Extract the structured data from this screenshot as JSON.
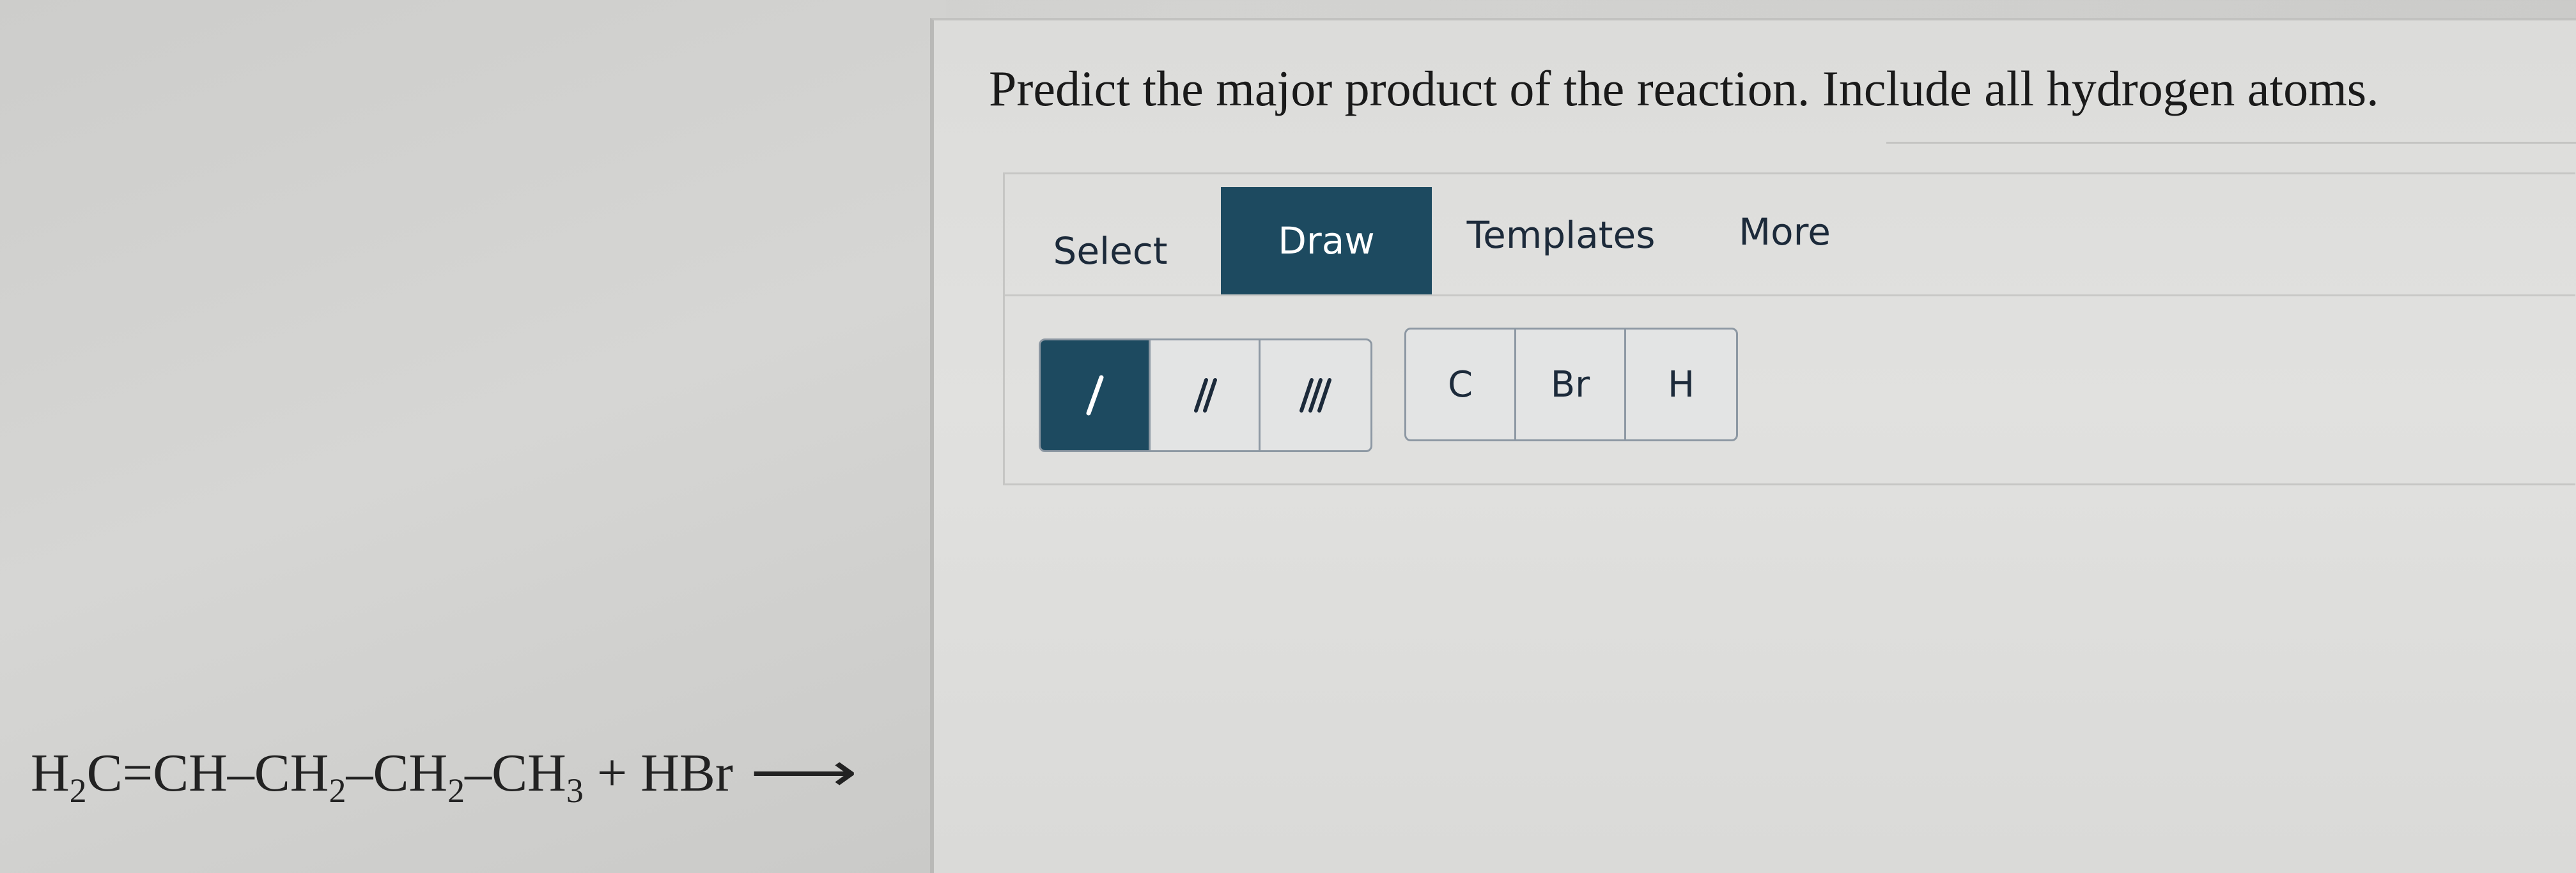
{
  "question": {
    "text": "Predict the major product of the reaction. Include all hydrogen atoms."
  },
  "toolbar": {
    "tabs": [
      {
        "label": "Select",
        "active": false
      },
      {
        "label": "Draw",
        "active": true
      },
      {
        "label": "Templates",
        "active": false
      },
      {
        "label": "More",
        "active": false
      }
    ]
  },
  "bond_tools": [
    {
      "icon": "single-bond-icon",
      "active": true
    },
    {
      "icon": "double-bond-icon",
      "active": false
    },
    {
      "icon": "triple-bond-icon",
      "active": false
    }
  ],
  "atom_tools": [
    {
      "label": "C"
    },
    {
      "label": "Br"
    },
    {
      "label": "H"
    }
  ],
  "reaction": {
    "h": "H",
    "sub2a": "2",
    "part1": "C=CH–CH",
    "sub2b": "2",
    "part2": "–CH",
    "sub2c": "2",
    "part3": "–CH",
    "sub3": "3",
    "part4": " + HBr",
    "arrow": "⟶"
  },
  "colors": {
    "accent": "#1d4a60",
    "tool_border": "#8d98a3",
    "text": "#1c2a3a"
  }
}
